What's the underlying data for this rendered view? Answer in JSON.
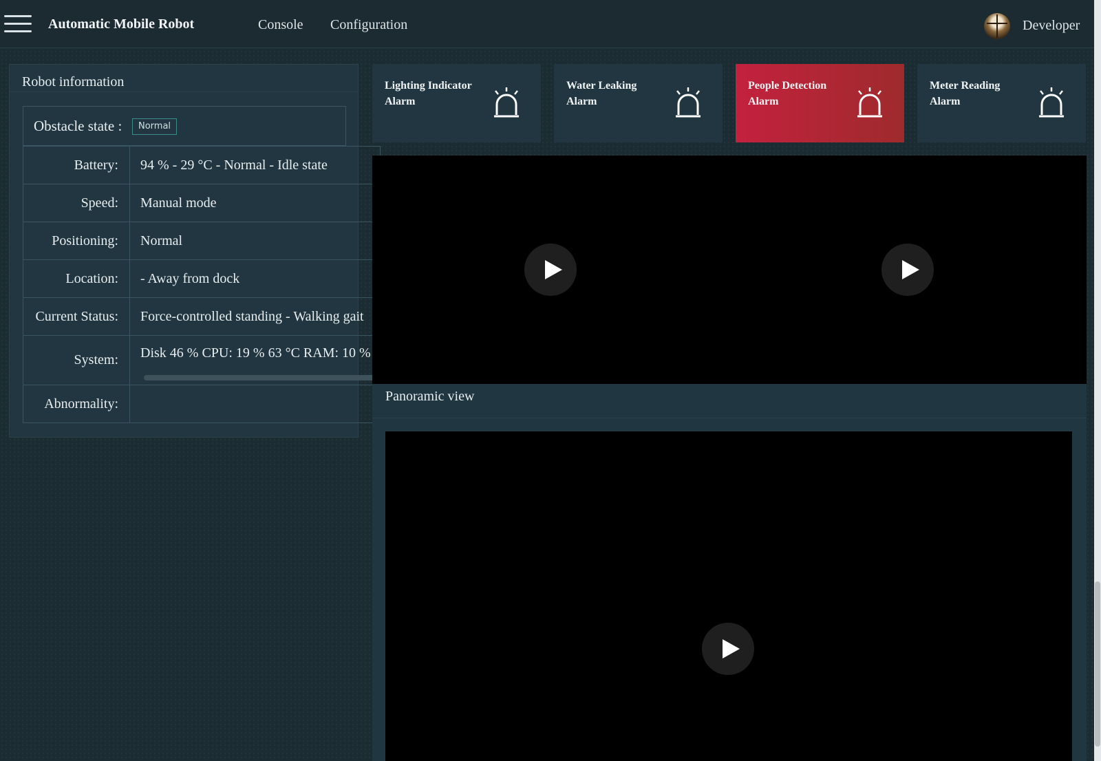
{
  "header": {
    "app_title": "Automatic Mobile Robot",
    "nav": [
      {
        "label": "Console"
      },
      {
        "label": "Configuration"
      }
    ],
    "user": "Developer"
  },
  "robot_info": {
    "title": "Robot information",
    "obstacle_label": "Obstacle state :",
    "obstacle_state": "Normal",
    "rows": [
      {
        "label": "Battery:",
        "value": "94 % - 29 °C - Normal - Idle state"
      },
      {
        "label": "Speed:",
        "value": "Manual mode"
      },
      {
        "label": "Positioning:",
        "value": "Normal"
      },
      {
        "label": "Location:",
        "value": "- Away from dock"
      },
      {
        "label": "Current Status:",
        "value": "Force-controlled standing - Walking gait"
      },
      {
        "label": "System:",
        "value": "Disk 46 % CPU: 19 % 63 °C RAM: 10 %"
      },
      {
        "label": "Abnormality:",
        "value": ""
      }
    ]
  },
  "alarms": [
    {
      "line1": "Lighting Indicator",
      "line2": "Alarm",
      "active": false
    },
    {
      "line1": "Water Leaking",
      "line2": "Alarm",
      "active": false
    },
    {
      "line1": "People Detection",
      "line2": "Alarm",
      "active": true
    },
    {
      "line1": "Meter Reading",
      "line2": "Alarm",
      "active": false
    }
  ],
  "panoramic": {
    "title": "Panoramic view"
  },
  "colors": {
    "background": "#1c2c33",
    "panel": "#213640",
    "alarm_active_start": "#c3213e",
    "alarm_active_end": "#9e2b2c",
    "badge_border": "#3e8a86"
  },
  "icons": [
    "menu-icon",
    "alarm-siren-icon",
    "play-icon"
  ]
}
